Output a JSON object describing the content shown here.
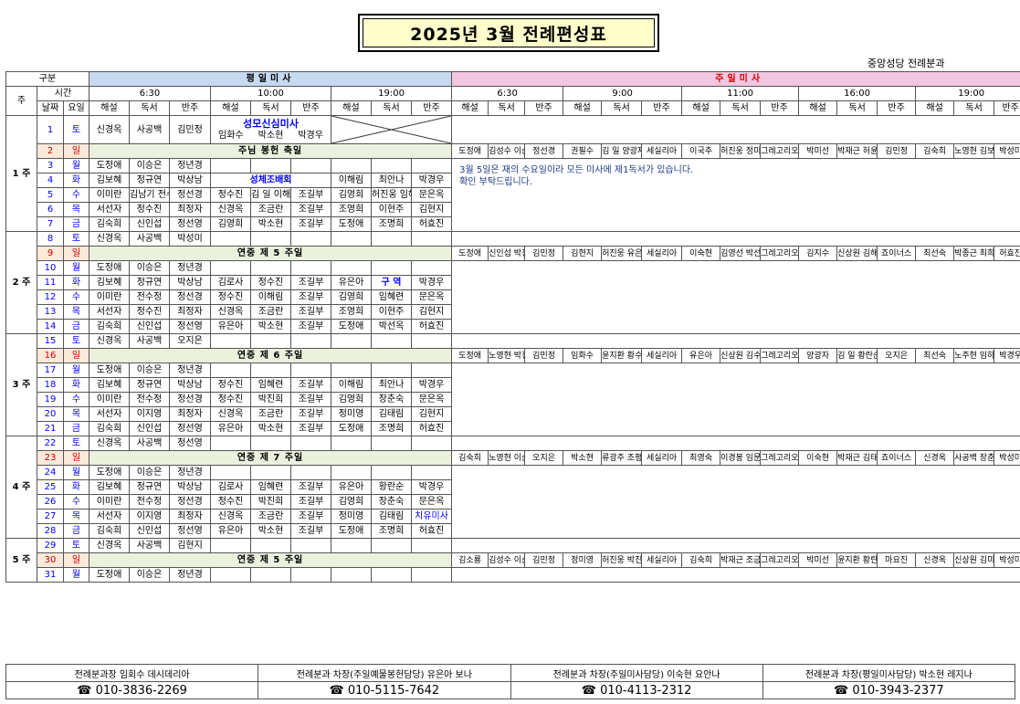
{
  "title": "2025년 3월 전례편성표",
  "dept": "중앙성당 전례분과",
  "header": {
    "gubun": "구분",
    "weekday_mass": "평일미사",
    "sunday_mass": "주일미사",
    "ju": "주",
    "sigan": "시간",
    "date": "날짜",
    "dow": "요일",
    "times_week": [
      "6:30",
      "10:00",
      "19:00"
    ],
    "times_sun": [
      "6:30",
      "9:00",
      "11:00",
      "16:00",
      "19:00"
    ],
    "roles": [
      "해설",
      "독서",
      "반주"
    ]
  },
  "weeks_labels": [
    "1 주",
    "2 주",
    "3 주",
    "4 주",
    "5 주"
  ],
  "note": [
    "3월 5일은 재의 수요일이라 모든 미사에 제1독서가 있습니다.",
    "확인 부탁드립니다."
  ],
  "rows": {
    "r1": {
      "d": "1",
      "w": "토",
      "a": [
        "신경옥",
        "사공백",
        "김민정"
      ],
      "special": "성모신심미사",
      "b": [
        "임화수",
        "박소현",
        "박경우"
      ]
    },
    "r2": {
      "d": "2",
      "w": "일",
      "feast": "주님 봉헌 축일",
      "s": [
        "도정애",
        "김성수 이순은",
        "정선경",
        "권필수",
        "김 일 양광자",
        "세실리아",
        "이국주",
        "허진웅 정미영",
        "그레고리오",
        "박미선",
        "박재근 허윤지",
        "김민정",
        "김숙희",
        "노영현 김보혜",
        "박성미"
      ]
    },
    "r3": {
      "d": "3",
      "w": "월",
      "a": [
        "도정애",
        "이승은",
        "정년경"
      ]
    },
    "r4": {
      "d": "4",
      "w": "화",
      "a": [
        "김보혜",
        "정규연",
        "박상남"
      ],
      "b10": "성체조배회",
      "c": [
        "이해림",
        "최안나",
        "박경우"
      ]
    },
    "r5": {
      "d": "5",
      "w": "수",
      "a": [
        "이미란",
        "김남기 전수정",
        "정선경"
      ],
      "b": [
        "정수진",
        "김 일 이해림",
        "조길부"
      ],
      "c": [
        "김영희",
        "허진웅 임혜련",
        "문은옥"
      ]
    },
    "r6": {
      "d": "6",
      "w": "목",
      "a": [
        "서선자",
        "정수진",
        "최정자"
      ],
      "b": [
        "신경옥",
        "조금란",
        "조길부"
      ],
      "c": [
        "조영희",
        "이현주",
        "김현지"
      ]
    },
    "r7": {
      "d": "7",
      "w": "금",
      "a": [
        "김숙희",
        "신인섭",
        "정선영"
      ],
      "b": [
        "김영희",
        "박소현",
        "조길부"
      ],
      "c": [
        "도정애",
        "조명희",
        "허효진"
      ]
    },
    "r8": {
      "d": "8",
      "w": "토",
      "a": [
        "신경옥",
        "사공백",
        "박성미"
      ]
    },
    "r9": {
      "d": "9",
      "w": "일",
      "feast": "연중 제 5 주일",
      "s": [
        "도정애",
        "신인섭 박진희",
        "김민정",
        "김현지",
        "허진웅 유은아",
        "세실리아",
        "이숙현",
        "김영선 박선옥",
        "그레고리오",
        "김지수",
        "신상원 김해림",
        "죠이너스",
        "최선숙",
        "박종근 최희열",
        "허효진"
      ]
    },
    "r10": {
      "d": "10",
      "w": "월",
      "a": [
        "도정애",
        "이승은",
        "정년경"
      ]
    },
    "r11": {
      "d": "11",
      "w": "화",
      "a": [
        "김보혜",
        "정규연",
        "박상남"
      ],
      "b": [
        "김로사",
        "정수진",
        "조길부"
      ],
      "c": [
        "유은아",
        "구 역",
        "박경우"
      ]
    },
    "r12": {
      "d": "12",
      "w": "수",
      "a": [
        "이미란",
        "전수정",
        "정선경"
      ],
      "b": [
        "정수진",
        "이해림",
        "조길부"
      ],
      "c": [
        "김영희",
        "임혜련",
        "문은옥"
      ]
    },
    "r13": {
      "d": "13",
      "w": "목",
      "a": [
        "서선자",
        "정수진",
        "최정자"
      ],
      "b": [
        "신경옥",
        "조금란",
        "조길부"
      ],
      "c": [
        "조영희",
        "이현주",
        "김현지"
      ]
    },
    "r14": {
      "d": "14",
      "w": "금",
      "a": [
        "김숙희",
        "신인섭",
        "정선영"
      ],
      "b": [
        "유은아",
        "박소현",
        "조길부"
      ],
      "c": [
        "도정애",
        "박선옥",
        "허효진"
      ]
    },
    "r15": {
      "d": "15",
      "w": "토",
      "a": [
        "신경옥",
        "사공백",
        "오지은"
      ]
    },
    "r16": {
      "d": "16",
      "w": "일",
      "feast": "연중 제 6 주일",
      "s": [
        "도정애",
        "노영현 박진희",
        "김민정",
        "임화수",
        "윤지환 황수정",
        "세실리아",
        "유은아",
        "신상원 김수희",
        "그레고리오",
        "양광자",
        "김 일 황란순",
        "오지은",
        "최선숙",
        "노주현 임하진",
        "박경우"
      ]
    },
    "r17": {
      "d": "17",
      "w": "월",
      "a": [
        "도정애",
        "이승은",
        "정년경"
      ]
    },
    "r18": {
      "d": "18",
      "w": "화",
      "a": [
        "김보혜",
        "정규연",
        "박상남"
      ],
      "b": [
        "정수진",
        "임혜련",
        "조길부"
      ],
      "c": [
        "이해림",
        "최안나",
        "박경우"
      ]
    },
    "r19": {
      "d": "19",
      "w": "수",
      "a": [
        "이미란",
        "전수정",
        "정선경"
      ],
      "b": [
        "정수진",
        "박진희",
        "조길부"
      ],
      "c": [
        "김영희",
        "장춘숙",
        "문은옥"
      ]
    },
    "r20": {
      "d": "20",
      "w": "목",
      "a": [
        "서선자",
        "이지영",
        "최정자"
      ],
      "b": [
        "신경옥",
        "조금란",
        "조길부"
      ],
      "c": [
        "정미영",
        "김태림",
        "김현지"
      ]
    },
    "r21": {
      "d": "21",
      "w": "금",
      "a": [
        "김숙희",
        "신인섭",
        "정선영"
      ],
      "b": [
        "유은아",
        "박소현",
        "조길부"
      ],
      "c": [
        "도정애",
        "조명희",
        "허효진"
      ]
    },
    "r22": {
      "d": "22",
      "w": "토",
      "a": [
        "신경옥",
        "사공백",
        "정선영"
      ]
    },
    "r23": {
      "d": "23",
      "w": "일",
      "feast": "연중 제 7 주일",
      "s": [
        "김숙희",
        "노영현 이순은",
        "오지은",
        "박소현",
        "류광주 조평희",
        "세실리아",
        "최영숙",
        "이경봉 임문주",
        "그레고리오",
        "이숙현",
        "박재근 김태주",
        "죠이너스",
        "신경옥",
        "사공백 장춘숙",
        "박성미"
      ]
    },
    "r24": {
      "d": "24",
      "w": "월",
      "a": [
        "도정애",
        "이승은",
        "정년경"
      ]
    },
    "r25": {
      "d": "25",
      "w": "화",
      "a": [
        "김보혜",
        "정규연",
        "박상남"
      ],
      "b": [
        "김로사",
        "임혜련",
        "조길부"
      ],
      "c": [
        "유은아",
        "황란순",
        "박경우"
      ]
    },
    "r26": {
      "d": "26",
      "w": "수",
      "a": [
        "이미란",
        "전수정",
        "정선경"
      ],
      "b": [
        "정수진",
        "박진희",
        "조길부"
      ],
      "c": [
        "김영희",
        "장춘숙",
        "문은옥"
      ]
    },
    "r27": {
      "d": "27",
      "w": "목",
      "a": [
        "서선자",
        "이지영",
        "최정자"
      ],
      "b": [
        "신경옥",
        "조금란",
        "조길부"
      ],
      "c": [
        "정미영",
        "김태림",
        "치유미사"
      ]
    },
    "r28": {
      "d": "28",
      "w": "금",
      "a": [
        "김숙희",
        "신인섭",
        "정선영"
      ],
      "b": [
        "유은아",
        "박소현",
        "조길부"
      ],
      "c": [
        "도정애",
        "조명희",
        "허효진"
      ]
    },
    "r29": {
      "d": "29",
      "w": "토",
      "a": [
        "신경옥",
        "사공백",
        "김현지"
      ]
    },
    "r30": {
      "d": "30",
      "w": "일",
      "feast": "연중 제 5 주일",
      "s": [
        "김소룡",
        "김성수 이순은",
        "김민정",
        "정미영",
        "허진웅 박진희",
        "세실리아",
        "김숙희",
        "박재근 조금난",
        "그레고리오",
        "박미선",
        "윤지환 황란주",
        "마요진",
        "신경옥",
        "신상원 김미정",
        "박성미"
      ]
    },
    "r31": {
      "d": "31",
      "w": "월",
      "a": [
        "도정애",
        "이승은",
        "정년경"
      ]
    }
  },
  "footer": [
    {
      "label": "전례분과장 임회수 데시데리아",
      "phone": "☎ 010-3836-2269"
    },
    {
      "label": "전례분과 차장(주일예물봉헌담당) 유은아 보나",
      "phone": "☎ 010-5115-7642"
    },
    {
      "label": "전례분과 차장(주일미사담당) 이숙현 요안나",
      "phone": "☎ 010-4113-2312"
    },
    {
      "label": "전례분과 차장(평일미사담당) 박소현 레지나",
      "phone": "☎ 010-3943-2377"
    }
  ]
}
